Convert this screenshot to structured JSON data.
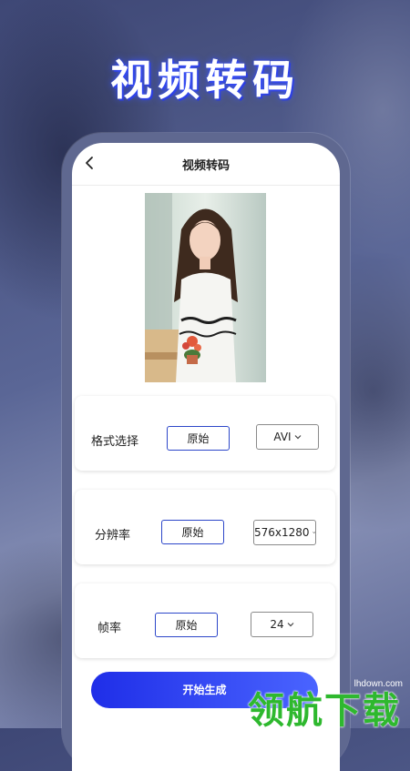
{
  "hero": {
    "title": "视频转码"
  },
  "nav": {
    "title": "视频转码"
  },
  "format": {
    "label": "格式选择",
    "original_label": "原始",
    "selected": "AVI"
  },
  "resolution": {
    "label": "分辨率",
    "original_label": "原始",
    "selected": "576x1280"
  },
  "framerate": {
    "label": "帧率",
    "original_label": "原始",
    "selected": "24"
  },
  "actions": {
    "start_label": "开始生成"
  },
  "watermark": {
    "url": "lhdown.com",
    "text": "领航下载"
  },
  "colors": {
    "accent": "#2c46c9",
    "button_start": "#1f2ee8",
    "button_end": "#4a64ff",
    "watermark": "#2eb82e"
  },
  "icons": {
    "back": "chevron-left-icon",
    "dropdown": "chevron-down-icon"
  }
}
